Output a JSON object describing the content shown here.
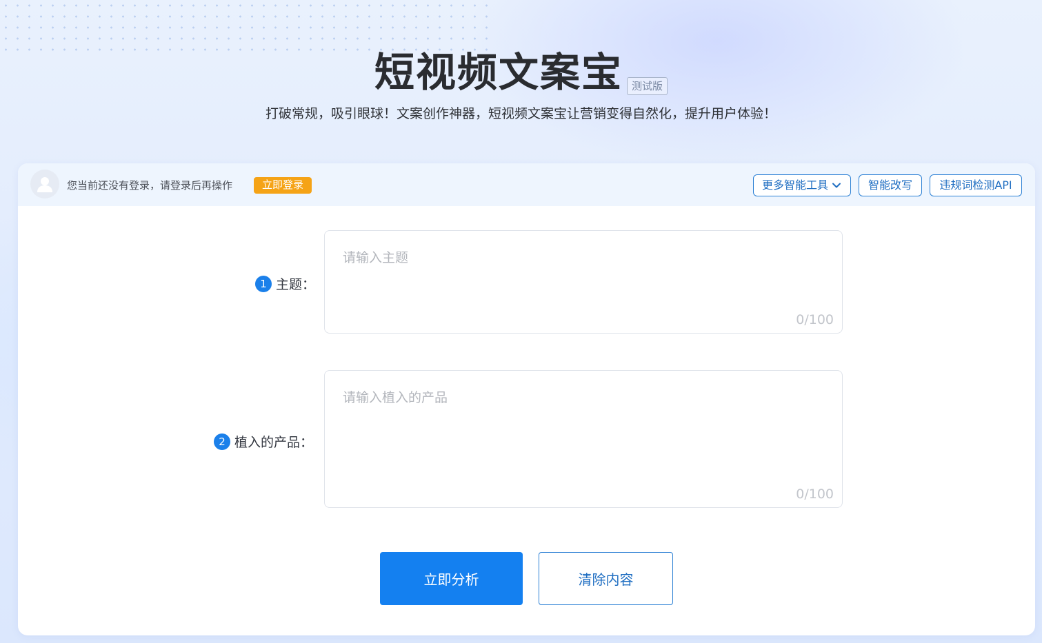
{
  "header": {
    "title": "短视频文案宝",
    "beta_tag": "测试版",
    "subtitle": "打破常规，吸引眼球！文案创作神器，短视频文案宝让营销变得自然化，提升用户体验！"
  },
  "toolbar": {
    "login_notice": "您当前还没有登录，请登录后再操作",
    "login_button": "立即登录",
    "more_tools": "更多智能工具",
    "rewrite": "智能改写",
    "api": "违规词检测API"
  },
  "form": {
    "topic": {
      "step": "1",
      "label": "主题：",
      "placeholder": "请输入主题",
      "counter": "0/100"
    },
    "product": {
      "step": "2",
      "label": "植入的产品：",
      "placeholder": "请输入植入的产品",
      "counter": "0/100"
    }
  },
  "actions": {
    "analyze": "立即分析",
    "clear": "清除内容"
  },
  "colors": {
    "primary": "#1480f0",
    "login_button": "#f5a316",
    "outline": "#2a7fd4"
  }
}
